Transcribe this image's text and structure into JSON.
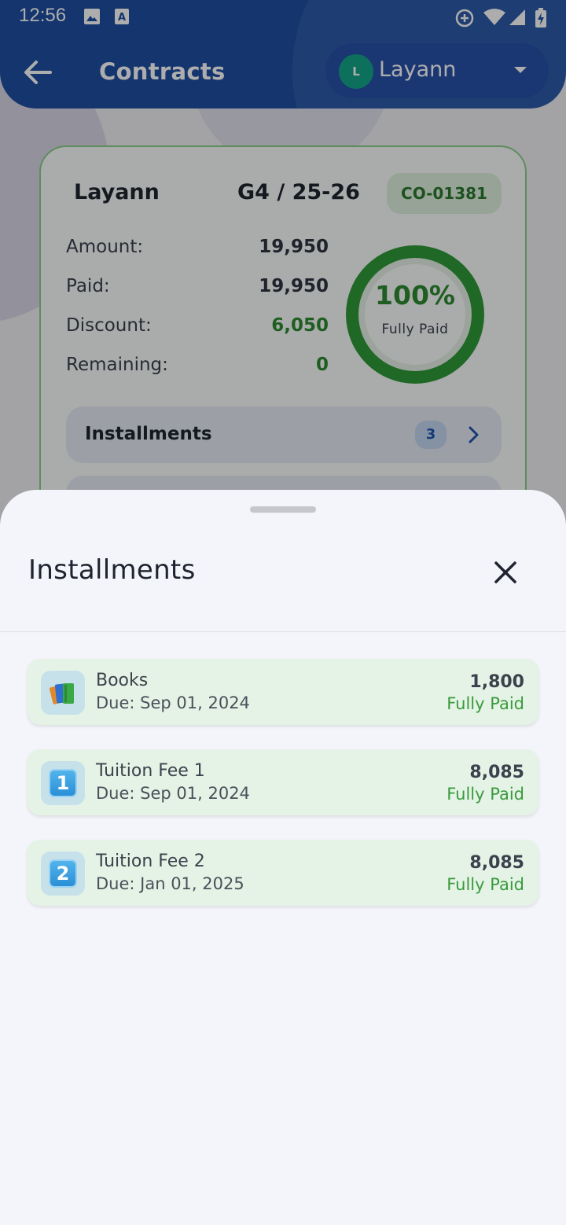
{
  "status_bar": {
    "time": "12:56"
  },
  "app_bar": {
    "title": "Contracts",
    "user": {
      "initial": "L",
      "name": "Layann"
    }
  },
  "contract": {
    "student": "Layann",
    "grade": "G4 / 25-26",
    "code": "CO-01381",
    "rows": [
      {
        "label": "Amount:",
        "value": "19,950"
      },
      {
        "label": "Paid:",
        "value": "19,950"
      },
      {
        "label": "Discount:",
        "value": "6,050"
      },
      {
        "label": "Remaining:",
        "value": "0"
      }
    ],
    "progress": {
      "percent_text": "100%",
      "fraction": 1.0,
      "status": "Fully Paid"
    },
    "installments_row": {
      "label": "Installments",
      "count": "3"
    }
  },
  "sheet": {
    "title": "Installments",
    "items": [
      {
        "icon": "books-icon",
        "name": "Books",
        "due": "Due: Sep 01, 2024",
        "amount": "1,800",
        "status": "Fully Paid"
      },
      {
        "icon": "keycap-one-icon",
        "glyph": "1",
        "name": "Tuition Fee 1",
        "due": "Due: Sep 01, 2024",
        "amount": "8,085",
        "status": "Fully Paid"
      },
      {
        "icon": "keycap-two-icon",
        "glyph": "2",
        "name": "Tuition Fee 2",
        "due": "Due: Jan 01, 2025",
        "amount": "8,085",
        "status": "Fully Paid"
      }
    ]
  },
  "colors": {
    "primary": "#1e4ea3",
    "success": "#2e8b32",
    "sheet_bg": "#f4f5fa",
    "item_bg": "#e4f3e5"
  }
}
